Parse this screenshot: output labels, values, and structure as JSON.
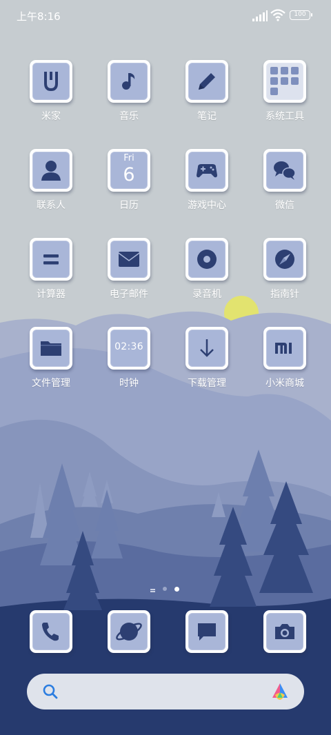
{
  "status": {
    "time": "上午8:16",
    "battery": "100"
  },
  "apps": [
    {
      "label": "米家",
      "icon": "mijia-icon"
    },
    {
      "label": "音乐",
      "icon": "music-note-icon"
    },
    {
      "label": "笔记",
      "icon": "pencil-icon"
    },
    {
      "label": "系统工具",
      "icon": "folder-grid-icon"
    },
    {
      "label": "联系人",
      "icon": "person-icon"
    },
    {
      "label": "日历",
      "icon": "calendar-icon",
      "day": "Fri",
      "date": "6"
    },
    {
      "label": "游戏中心",
      "icon": "gamepad-icon"
    },
    {
      "label": "微信",
      "icon": "chat-bubbles-icon"
    },
    {
      "label": "计算器",
      "icon": "equals-icon"
    },
    {
      "label": "电子邮件",
      "icon": "envelope-icon"
    },
    {
      "label": "录音机",
      "icon": "record-icon"
    },
    {
      "label": "指南针",
      "icon": "compass-icon"
    },
    {
      "label": "文件管理",
      "icon": "folder-icon"
    },
    {
      "label": "时钟",
      "icon": "clock-icon",
      "clock": "02:36"
    },
    {
      "label": "下载管理",
      "icon": "download-arrow-icon"
    },
    {
      "label": "小米商城",
      "icon": "mi-logo-icon"
    }
  ],
  "dock": [
    {
      "icon": "phone-icon"
    },
    {
      "icon": "browser-globe-icon"
    },
    {
      "icon": "message-bubble-icon"
    },
    {
      "icon": "camera-icon"
    }
  ],
  "page_indicator": {
    "pages": 3,
    "current": 2
  },
  "search": {
    "icon": "search-icon",
    "assistant": "assistant-logo-icon"
  },
  "colors": {
    "tile": "#a9b6d8",
    "glyph": "#2d3f72",
    "sky": "#c6ccd0",
    "sun": "#e2e36f"
  }
}
